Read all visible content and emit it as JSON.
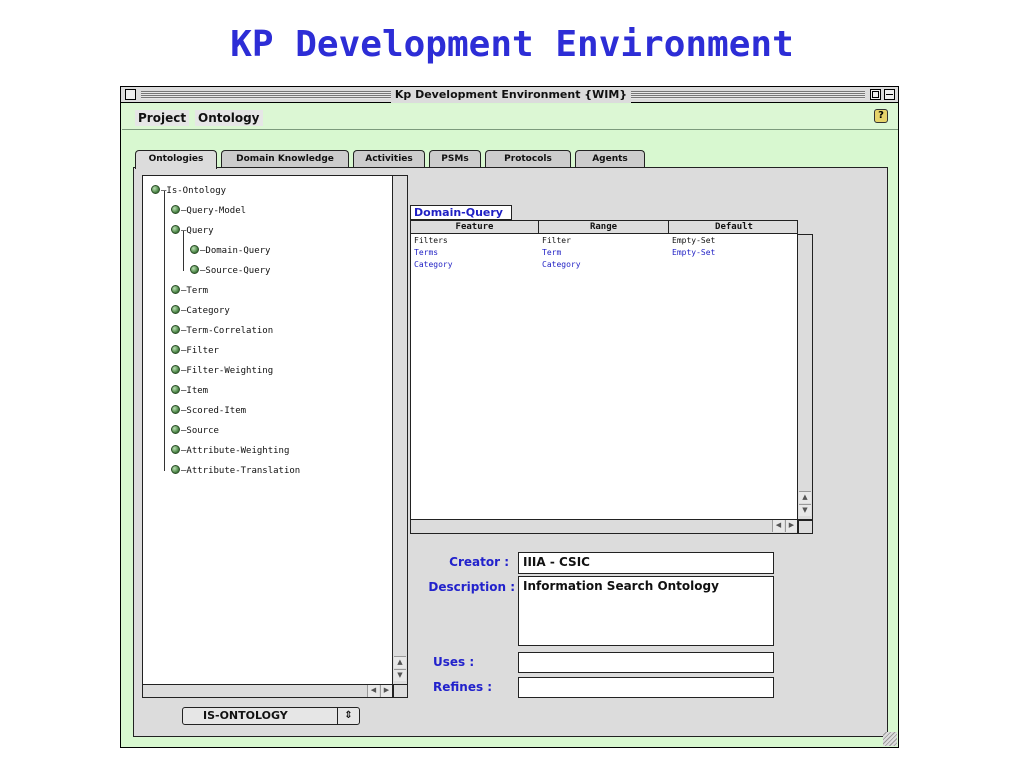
{
  "slide": {
    "title": "KP Development Environment"
  },
  "window": {
    "title": "Kp Development Environment {WIM}"
  },
  "menubar": {
    "items": [
      "Project",
      "Ontology"
    ]
  },
  "tabs": [
    "Ontologies",
    "Domain Knowledge",
    "Activities",
    "PSMs",
    "Protocols",
    "Agents"
  ],
  "active_tab": "Ontologies",
  "tree": {
    "nodes": [
      "Is-Ontology",
      "Query-Model",
      "Query",
      "Domain-Query",
      "Source-Query",
      "Term",
      "Category",
      "Term-Correlation",
      "Filter",
      "Filter-Weighting",
      "Item",
      "Scored-Item",
      "Source",
      "Attribute-Weighting",
      "Attribute-Translation"
    ]
  },
  "frame": {
    "name": "Domain-Query",
    "columns": [
      "Feature",
      "Range",
      "Default"
    ],
    "rows": [
      [
        "Filters",
        "Filter",
        "Empty-Set"
      ],
      [
        "Terms",
        "Term",
        "Empty-Set"
      ],
      [
        "Category",
        "Category",
        ""
      ]
    ]
  },
  "form": {
    "creator_label": "Creator :",
    "creator_value": "IIIA - CSIC",
    "description_label": "Description :",
    "description_value": "Information Search Ontology",
    "uses_label": "Uses :",
    "uses_value": "",
    "refines_label": "Refines :",
    "refines_value": ""
  },
  "ontology_select": {
    "selected": "IS-ONTOLOGY"
  },
  "colors": {
    "title_blue": "#2d2dd6",
    "window_green": "#d8f8d0",
    "label_blue": "#2222cc"
  },
  "icons": {
    "help": "help-icon",
    "tree_bullet": "bullet-icon"
  }
}
